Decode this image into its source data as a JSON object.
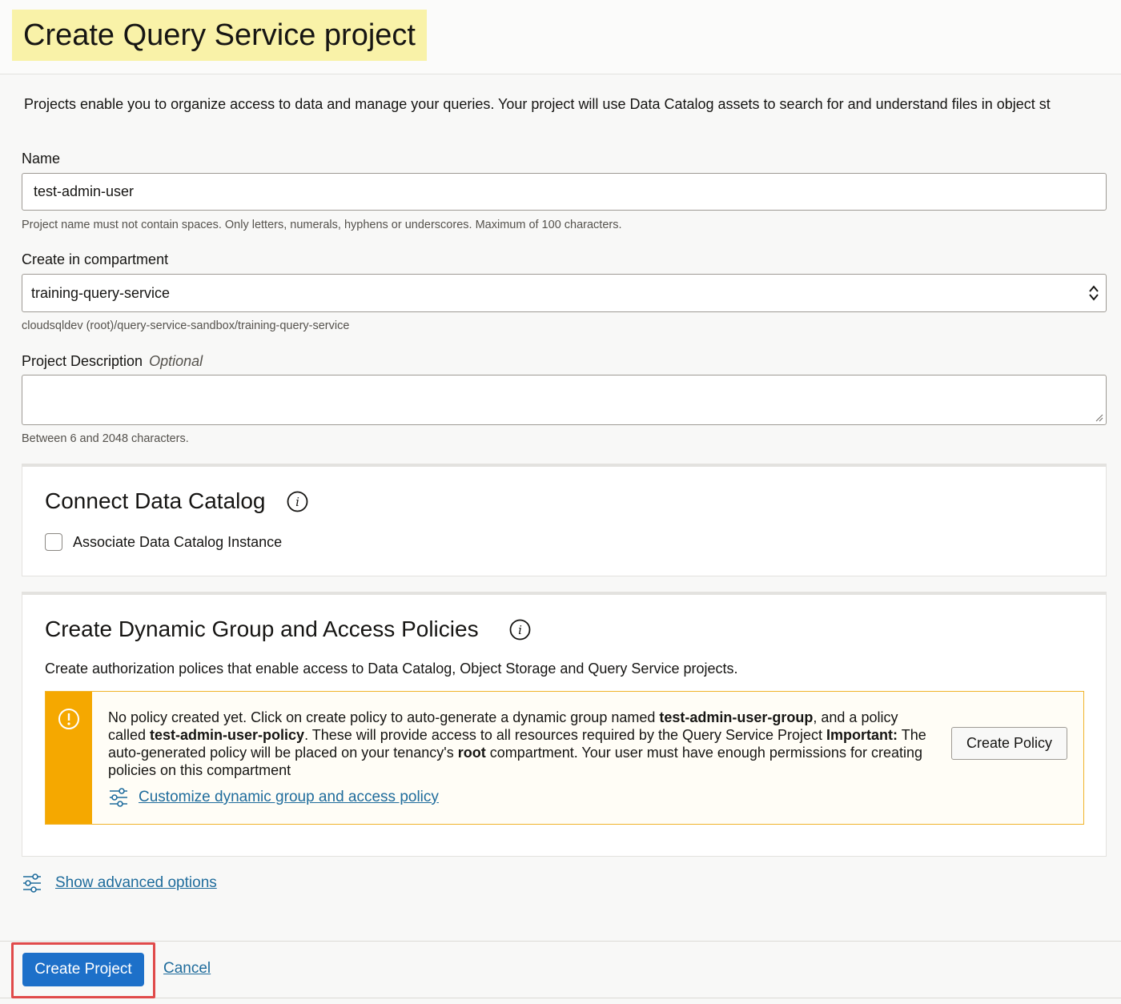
{
  "header": {
    "title": "Create Query Service project"
  },
  "intro": "Projects enable you to organize access to data and manage your queries. Your project will use Data Catalog assets to search for and understand files in object st",
  "form": {
    "name": {
      "label": "Name",
      "value": "test-admin-user",
      "help": "Project name must not contain spaces. Only letters, numerals, hyphens or underscores. Maximum of 100 characters."
    },
    "compartment": {
      "label": "Create in compartment",
      "value": "training-query-service",
      "path": "cloudsqldev (root)/query-service-sandbox/training-query-service"
    },
    "description": {
      "label": "Project Description",
      "optional": "Optional",
      "value": "",
      "help": "Between 6 and 2048 characters."
    }
  },
  "data_catalog": {
    "title": "Connect Data Catalog",
    "checkbox_label": "Associate Data Catalog Instance",
    "checked": false
  },
  "policies": {
    "title": "Create Dynamic Group and Access Policies",
    "description": "Create authorization polices that enable access to Data Catalog, Object Storage and Query Service projects.",
    "warning": {
      "t1": "No policy created yet. Click on create policy to auto-generate a dynamic group named ",
      "group_name": "test-admin-user-group",
      "t2": ", and a policy called ",
      "policy_name": "test-admin-user-policy",
      "t3": ". These will provide access to all resources required by the Query Service Project ",
      "important": "Important:",
      "t4": " The auto-generated policy will be placed on your tenancy's ",
      "root": "root",
      "t5": " compartment. Your user must have enough permissions for creating policies on this compartment",
      "link": "Customize dynamic group and access policy",
      "button": "Create Policy"
    }
  },
  "advanced_link": "Show advanced options",
  "footer": {
    "primary": "Create Project",
    "cancel": "Cancel"
  },
  "colors": {
    "primary": "#1d70c9",
    "link": "#1f6c9c",
    "warning": "#f5a800",
    "highlight": "#f9f2a8",
    "focus": "#e04a4a"
  },
  "icons": [
    "info-icon",
    "warning-icon",
    "sliders-icon",
    "select-arrows-icon",
    "resize-handle-icon"
  ]
}
